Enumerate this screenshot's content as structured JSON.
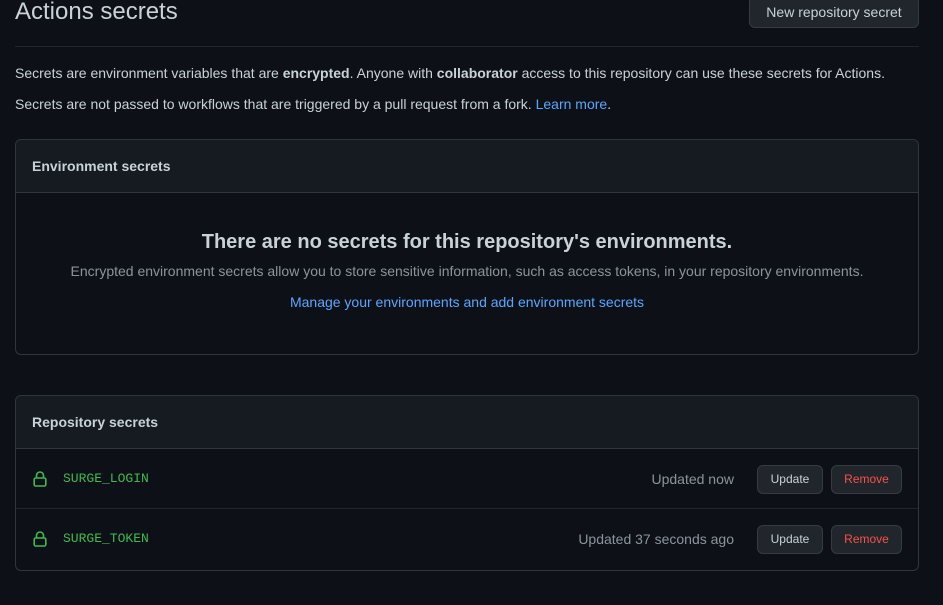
{
  "header": {
    "title": "Actions secrets",
    "new_secret_label": "New repository secret"
  },
  "intro": {
    "line1_a": "Secrets are environment variables that are ",
    "line1_b": "encrypted",
    "line1_c": ". Anyone with ",
    "line1_d": "collaborator",
    "line1_e": " access to this repository can use these secrets for Actions.",
    "line2_text": "Secrets are not passed to workflows that are triggered by a pull request from a fork. ",
    "line2_link": "Learn more",
    "line2_end": "."
  },
  "environment_secrets": {
    "heading": "Environment secrets",
    "empty_title": "There are no secrets for this repository's environments.",
    "empty_description": "Encrypted environment secrets allow you to store sensitive information, such as access tokens, in your repository environments.",
    "manage_link": "Manage your environments and add environment secrets"
  },
  "repository_secrets": {
    "heading": "Repository secrets",
    "items": [
      {
        "name": "SURGE_LOGIN",
        "updated": "Updated now",
        "update_label": "Update",
        "remove_label": "Remove",
        "icon": "lock-icon"
      },
      {
        "name": "SURGE_TOKEN",
        "updated": "Updated 37 seconds ago",
        "update_label": "Update",
        "remove_label": "Remove",
        "icon": "lock-icon"
      }
    ]
  },
  "colors": {
    "background": "#0d1117",
    "text": "#c9d1d9",
    "muted": "#8b949e",
    "link": "#58a6ff",
    "secret_name": "#3fb950",
    "danger": "#f85149"
  }
}
